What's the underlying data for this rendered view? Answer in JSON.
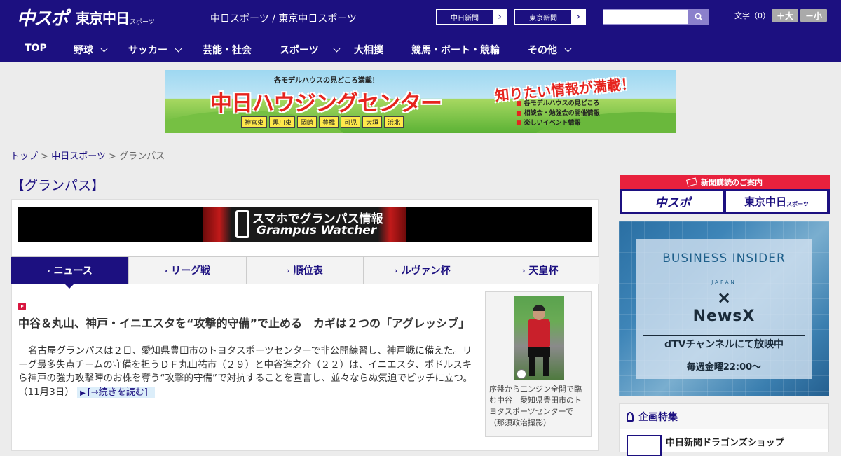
{
  "header": {
    "logo_main": "中スポ",
    "logo_tokyo": "東京中日",
    "logo_sports": "スポーツ",
    "site_title": "中日スポーツ / 東京中日スポーツ",
    "link_chunichi": "中日新聞",
    "link_tokyo": "東京新聞",
    "search_placeholder": "",
    "font_size_label": "文字（0）",
    "font_larger": "＋大",
    "font_smaller": "－小"
  },
  "nav": {
    "items": [
      {
        "label": "TOP",
        "has_menu": false
      },
      {
        "label": "野球",
        "has_menu": true
      },
      {
        "label": "サッカー",
        "has_menu": true
      },
      {
        "label": "芸能・社会",
        "has_menu": false
      },
      {
        "label": "スポーツ",
        "has_menu": true
      },
      {
        "label": "大相撲",
        "has_menu": false
      },
      {
        "label": "競馬・ボート・競輪",
        "has_menu": false
      },
      {
        "label": "その他",
        "has_menu": true
      }
    ]
  },
  "banner": {
    "sub": "各モデルハウスの見どころ満載！",
    "main": "中日ハウジングセンター",
    "catch": "知りたい情報が満載！",
    "locations": [
      "神宮東",
      "黒川東",
      "岡崎",
      "豊橋",
      "可児",
      "大垣",
      "浜北"
    ],
    "points": [
      "各モデルハウスの見どころ",
      "相談会・勉強会の開催情報",
      "楽しいイベント情報"
    ]
  },
  "breadcrumb": {
    "home": "トップ",
    "section": "中日スポーツ",
    "current": "グランパス",
    "separator": ">"
  },
  "page_title": "【グランパス】",
  "grampus_watcher": {
    "line1": "スマホでグランパス情報",
    "line2": "Grampus Watcher"
  },
  "tabs": [
    {
      "label": "ニュース",
      "active": true
    },
    {
      "label": "リーグ戦",
      "active": false
    },
    {
      "label": "順位表",
      "active": false
    },
    {
      "label": "ルヴァン杯",
      "active": false
    },
    {
      "label": "天皇杯",
      "active": false
    }
  ],
  "article": {
    "title": "中谷＆丸山、神戸・イニエスタを“攻撃的守備”で止める　カギは２つの「アグレッシブ」",
    "body": "名古屋グランパスは２日、愛知県豊田市のトヨタスポーツセンターで非公開練習し、神戸戦に備えた。リーグ最多失点チームの守備を担うＤＦ丸山祐市（２９）と中谷進之介（２２）は、イニエスタ、ポドルスキら神戸の強力攻撃陣のお株を奪う“攻撃的守備”で対抗することを宣言し、並々ならぬ気迫でピッチに立つ。",
    "date": "（11月3日）",
    "more": "[→続きを読む]",
    "photo_caption": "序盤からエンジン全開で臨む中谷＝愛知県豊田市のトヨタスポーツセンターで（那須政治撮影）"
  },
  "sidebar": {
    "subscribe_header": "新聞購読のご案内",
    "sub_logo_1": "中スポ",
    "sub_logo_2": "東京中日",
    "sub_logo_2s": "スポーツ",
    "ad": {
      "brand": "BUSINESS INSIDER",
      "brand_sub": "JAPAN",
      "cross": "×",
      "partner": "NewsX",
      "channel": "dTVチャンネルにて放映中",
      "schedule": "毎週金曜22:00〜"
    },
    "feature_header": "企画特集",
    "feature_item": "中日新聞ドラゴンズショップ"
  },
  "colors": {
    "brand_navy": "#1c1080",
    "accent_red": "#e8213d",
    "more_link_bg": "#dceefa"
  }
}
